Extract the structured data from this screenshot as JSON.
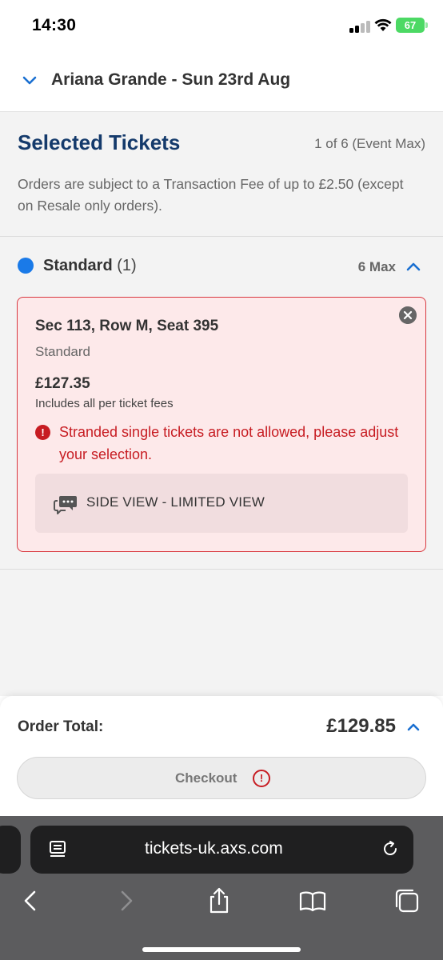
{
  "status_bar": {
    "time": "14:30",
    "battery": "67"
  },
  "event": {
    "title": "Ariana Grande - Sun 23rd Aug"
  },
  "selected": {
    "title": "Selected Tickets",
    "count": "1 of 6 (Event Max)",
    "fee_note": "Orders are subject to a Transaction Fee of up to £2.50 (except on Resale only orders)."
  },
  "category": {
    "name": "Standard",
    "qty": "(1)",
    "max": "6 Max",
    "color": "#1a7ae8"
  },
  "ticket": {
    "seat": "Sec 113, Row M, Seat 395",
    "type": "Standard",
    "price": "£127.35",
    "fees_note": "Includes all per ticket fees",
    "error": "Stranded single tickets are not allowed, please adjust your selection.",
    "view_note": "SIDE VIEW - LIMITED VIEW"
  },
  "order": {
    "label": "Order Total:",
    "total": "£129.85",
    "checkout_label": "Checkout"
  },
  "browser": {
    "url": "tickets-uk.axs.com"
  },
  "colors": {
    "brand_navy": "#143a6b",
    "accent_blue": "#1a7ae8",
    "error_red": "#c71c22",
    "error_bg": "#fde9ea"
  },
  "icons": [
    "chevron-down-icon",
    "chevron-up-icon",
    "close-icon",
    "alert-icon",
    "speech-bubble-icon",
    "reader-icon",
    "reload-icon",
    "back-icon",
    "forward-icon",
    "share-icon",
    "bookmarks-icon",
    "tabs-icon"
  ]
}
